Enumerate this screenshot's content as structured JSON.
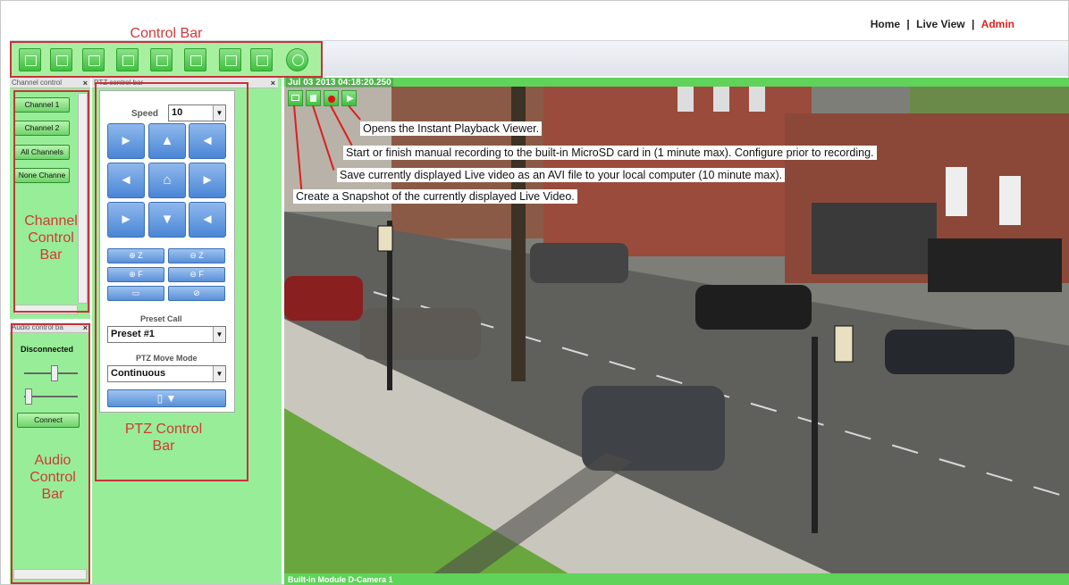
{
  "nav": {
    "home": "Home",
    "sep1": "|",
    "live_view": "Live View",
    "sep2": "|",
    "admin": "Admin"
  },
  "labels": {
    "control_bar": "Control Bar",
    "channel_control_bar": "Channel\nControl\nBar",
    "ptz_control_bar": "PTZ Control\nBar",
    "audio_control_bar": "Audio\nControl\nBar"
  },
  "channel_panel": {
    "title": "Channel control",
    "close": "×",
    "buttons": [
      "Channel 1",
      "Channel 2",
      "All Channels",
      "None Channe"
    ]
  },
  "ptz_panel": {
    "title": "PTZ control bar",
    "close": "×",
    "speed_label": "Speed",
    "speed_value": "10",
    "preset_call_label": "Preset Call",
    "preset_value": "Preset #1",
    "move_mode_label": "PTZ Move Mode",
    "move_mode_value": "Continuous",
    "zoom_buttons": [
      "Z",
      "Z",
      "F",
      "F"
    ]
  },
  "audio_panel": {
    "title": "Audio control ba",
    "close": "×",
    "status": "Disconnected",
    "connect": "Connect"
  },
  "video": {
    "timestamp": "Jul 03 2013 04:18:20.250",
    "footer": "Built-in Module D-Camera 1"
  },
  "callouts": {
    "playback": "Opens the Instant Playback Viewer.",
    "record": "Start or finish manual recording to the built-in MicroSD card in (1 minute max).  Configure prior to recording.",
    "save": "Save currently displayed Live video as an AVI file to your local computer (10 minute max).",
    "snapshot": "Create a Snapshot of the currently displayed Live Video."
  },
  "colors": {
    "accent_red": "#d23838",
    "panel_green": "#98ee98",
    "button_blue": "#4a86d6"
  }
}
